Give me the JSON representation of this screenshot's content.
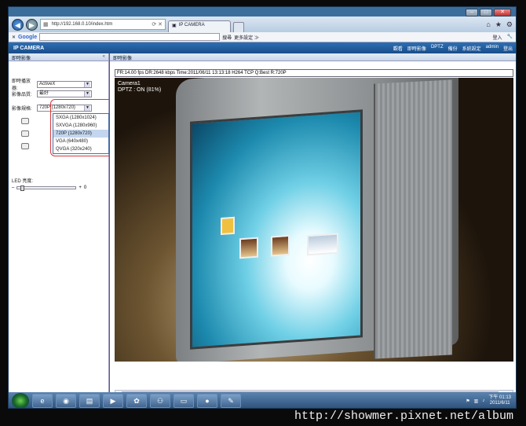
{
  "browser": {
    "url": "http://192.168.0.10/index.htm",
    "tab_title": "IP CAMERA",
    "google_label": "Google",
    "search_label": "搜尋",
    "more_label": "更多設定 ≫",
    "login_label": "登入"
  },
  "app": {
    "title": "IP CAMERA",
    "menu": [
      "觀看",
      "即時影像",
      "DPTZ",
      "備份",
      "系統設定",
      "admin",
      "登出"
    ]
  },
  "left_panel": {
    "header": "即時影像",
    "player_label": "即時播放器:",
    "player_value": "ActiveX",
    "quality_label": "影像品質:",
    "quality_value": "最好",
    "resolution_label": "影像規格:",
    "resolution_value": "720P (1280x720)",
    "resolution_options": [
      "SXGA (1280x1024)",
      "SXVGA (1280x960)",
      "720P (1280x720)",
      "VGA (640x480)",
      "QVGA (320x240)"
    ],
    "led_label": "LED 亮度:",
    "led_value": "0",
    "led_level": 0.05
  },
  "main": {
    "header": "即時影像",
    "info_line": "FR:14.00 fps  DR:2648 kbps Time:2011/06/11 13:13:18 H264 TCP Q:Best R:720P",
    "camera_name": "Camera1",
    "dptz_status": "DPTZ : ON  (81%)"
  },
  "taskbar": {
    "clock_time": "下午 01:13",
    "clock_date": "2011/6/11"
  },
  "watermark": "http://showmer.pixnet.net/album"
}
